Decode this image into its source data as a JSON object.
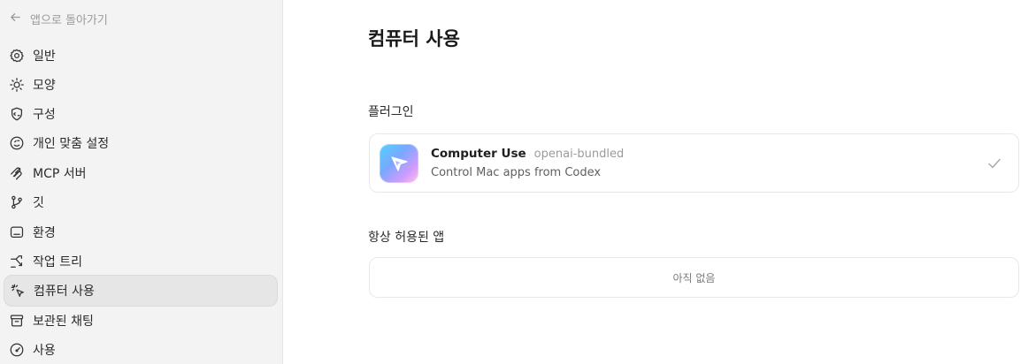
{
  "sidebar": {
    "back_label": "앱으로 돌아가기",
    "items": [
      {
        "label": "일반",
        "icon": "gear-icon"
      },
      {
        "label": "모양",
        "icon": "sun-icon"
      },
      {
        "label": "구성",
        "icon": "shield-code-icon"
      },
      {
        "label": "개인 맞춤 설정",
        "icon": "face-icon"
      },
      {
        "label": "MCP 서버",
        "icon": "plug-icon"
      },
      {
        "label": "깃",
        "icon": "git-branch-icon"
      },
      {
        "label": "환경",
        "icon": "monitor-icon"
      },
      {
        "label": "작업 트리",
        "icon": "tree-icon"
      },
      {
        "label": "컴퓨터 사용",
        "icon": "cursor-click-icon",
        "active": true
      },
      {
        "label": "보관된 채팅",
        "icon": "archive-icon"
      },
      {
        "label": "사용",
        "icon": "gauge-icon"
      }
    ]
  },
  "main": {
    "title": "컴퓨터 사용",
    "plugins_section": "플러그인",
    "plugin": {
      "name": "Computer Use",
      "source": "openai-bundled",
      "description": "Control Mac apps from Codex",
      "icon": "cursor-arrow-logo",
      "enabled": true
    },
    "allowed_apps_section": "항상 허용된 앱",
    "allowed_apps_empty": "아직 없음"
  }
}
